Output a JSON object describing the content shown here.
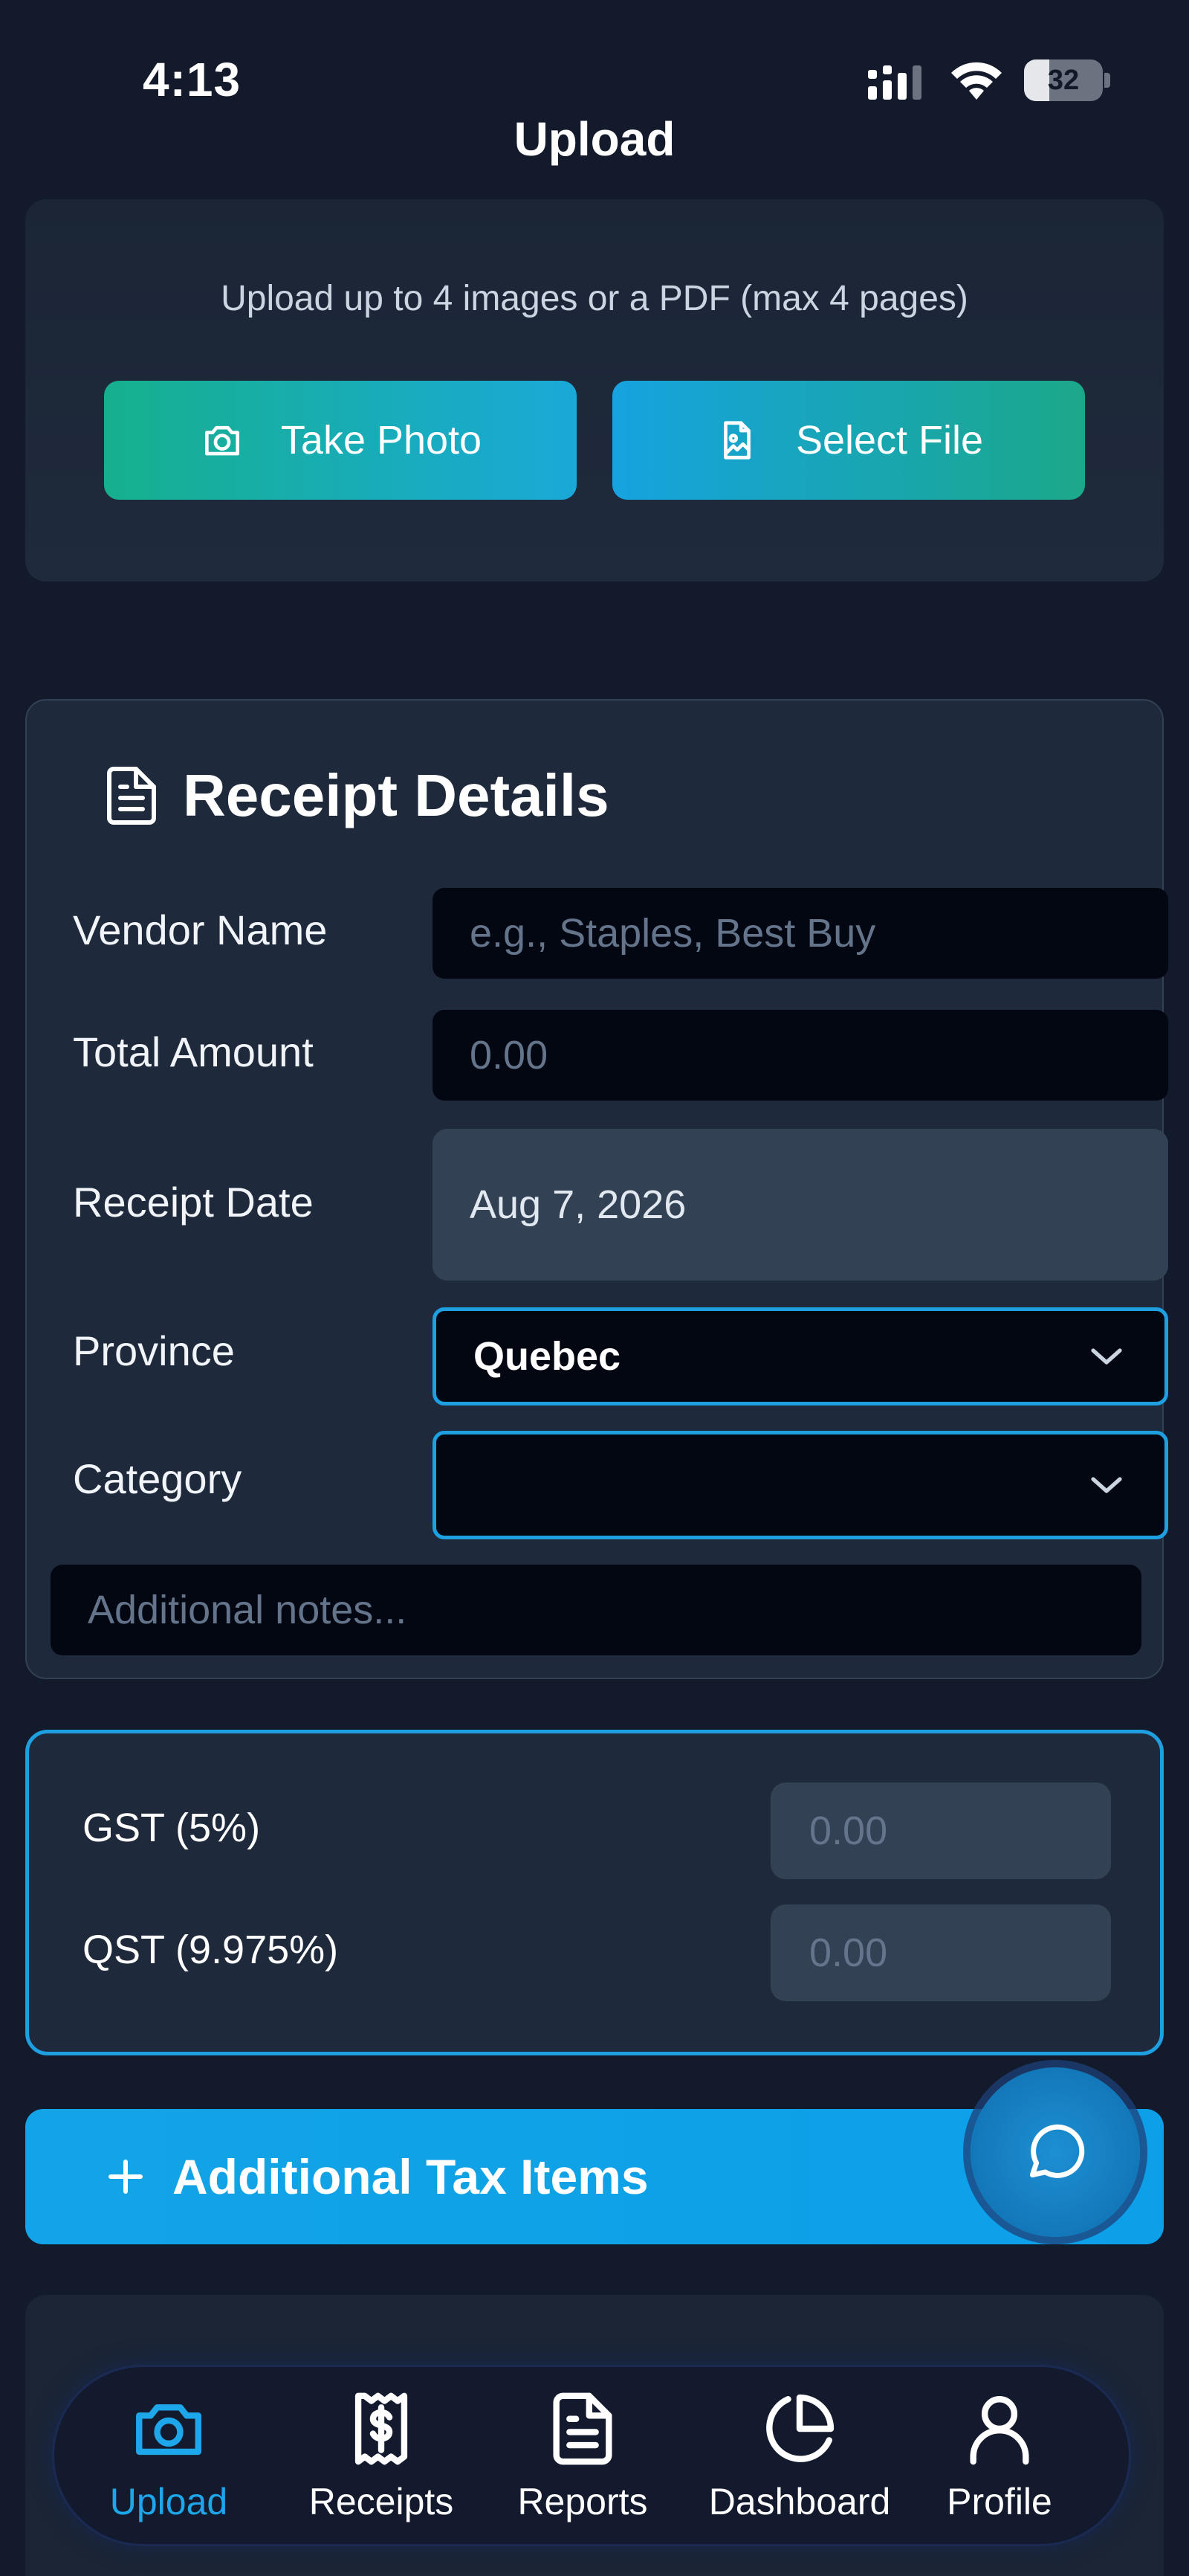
{
  "status_bar": {
    "time": "4:13",
    "battery": "32",
    "battery_level": 0.32
  },
  "header": {
    "title": "Upload"
  },
  "upload_card": {
    "hint": "Upload up to 4 images or a PDF (max 4 pages)",
    "take_photo_label": "Take Photo",
    "select_file_label": "Select File",
    "take_photo_icon": "camera-icon",
    "select_file_icon": "file-image-icon"
  },
  "receipt_details": {
    "title": "Receipt Details",
    "icon": "document-icon",
    "fields": {
      "vendor": {
        "label": "Vendor Name",
        "value": "",
        "placeholder": "e.g., Staples, Best Buy"
      },
      "total": {
        "label": "Total Amount",
        "value": "",
        "placeholder": "0.00"
      },
      "date": {
        "label": "Receipt Date",
        "value": "Aug 7, 2026"
      },
      "province": {
        "label": "Province",
        "value": "Quebec"
      },
      "category": {
        "label": "Category",
        "value": ""
      },
      "notes": {
        "value": "",
        "placeholder": "Additional notes..."
      }
    }
  },
  "taxes": {
    "gst": {
      "label": "GST (5%)",
      "placeholder": "0.00"
    },
    "qst": {
      "label": "QST (9.975%)",
      "placeholder": "0.00"
    }
  },
  "additional_tax": {
    "label": "Additional Tax Items",
    "icon": "plus-icon"
  },
  "chat": {
    "icon": "chat-bubble-icon"
  },
  "tabs": [
    {
      "label": "Upload",
      "icon": "camera-icon",
      "active": true
    },
    {
      "label": "Receipts",
      "icon": "receipt-icon",
      "active": false
    },
    {
      "label": "Reports",
      "icon": "document-icon",
      "active": false
    },
    {
      "label": "Dashboard",
      "icon": "pie-chart-icon",
      "active": false
    },
    {
      "label": "Profile",
      "icon": "user-icon",
      "active": false
    }
  ],
  "colors": {
    "accent": "#1ea6ea",
    "green": "#16b08e",
    "background": "#121a2b",
    "card": "#1e293b"
  }
}
